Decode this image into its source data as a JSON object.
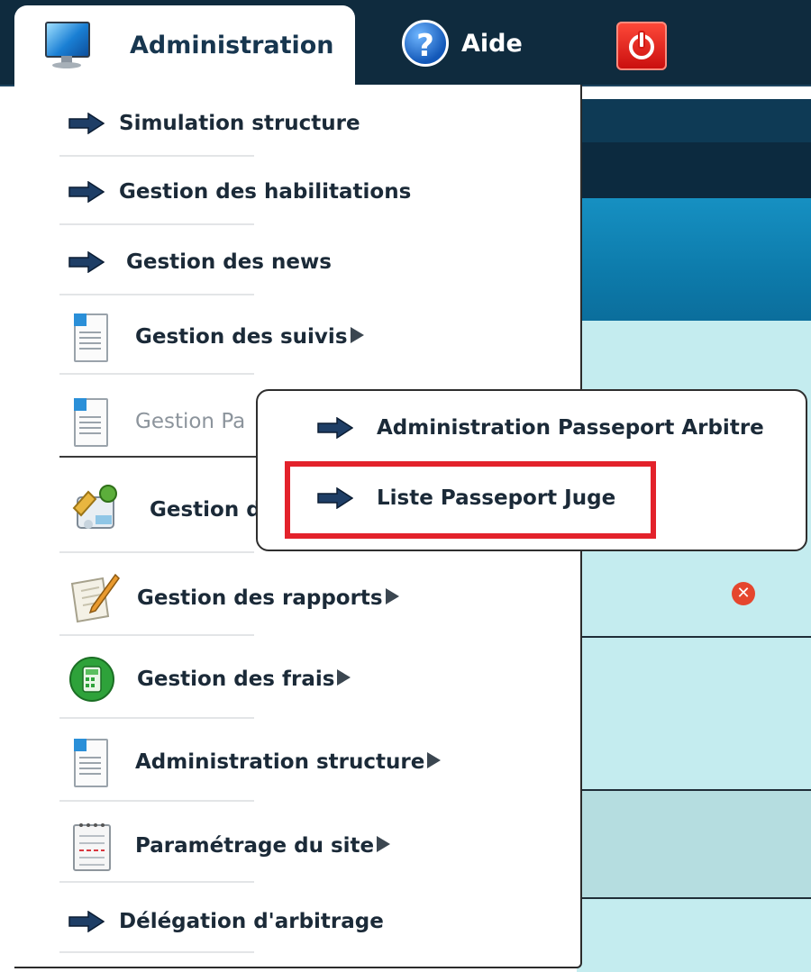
{
  "topbar": {
    "administration_label": "Administration",
    "help_label": "Aide"
  },
  "menu": {
    "items": [
      {
        "label": "Simulation structure",
        "icon": "arrow-right-icon",
        "has_submenu": false
      },
      {
        "label": "Gestion des habilitations",
        "icon": "arrow-right-icon",
        "has_submenu": false
      },
      {
        "label": "Gestion des news",
        "icon": "arrow-right-icon",
        "has_submenu": false
      },
      {
        "label": "Gestion des suivis",
        "icon": "document-icon",
        "has_submenu": true
      },
      {
        "label": "Gestion Pa",
        "icon": "document-icon",
        "has_submenu": true,
        "state": "active-partially-covered"
      },
      {
        "label": "Gestion d",
        "icon": "tools-icon",
        "has_submenu": true,
        "state": "partially-covered"
      },
      {
        "label": "Gestion des rapports",
        "icon": "notepad-pencil-icon",
        "has_submenu": true
      },
      {
        "label": "Gestion des frais",
        "icon": "calculator-icon",
        "has_submenu": true
      },
      {
        "label": "Administration structure",
        "icon": "document-icon",
        "has_submenu": true
      },
      {
        "label": "Paramétrage du site",
        "icon": "notebook-icon",
        "has_submenu": true
      },
      {
        "label": "Délégation d'arbitrage",
        "icon": "arrow-right-icon",
        "has_submenu": false
      }
    ]
  },
  "submenu": {
    "items": [
      {
        "label": "Administration Passeport Arbitre",
        "icon": "arrow-right-icon"
      },
      {
        "label": "Liste Passeport Juge",
        "icon": "arrow-right-icon",
        "highlighted": true
      }
    ]
  },
  "colors": {
    "topbar": "#0f2b3e",
    "highlight_border": "#e3222b",
    "background_rows": "#c4ecef"
  }
}
